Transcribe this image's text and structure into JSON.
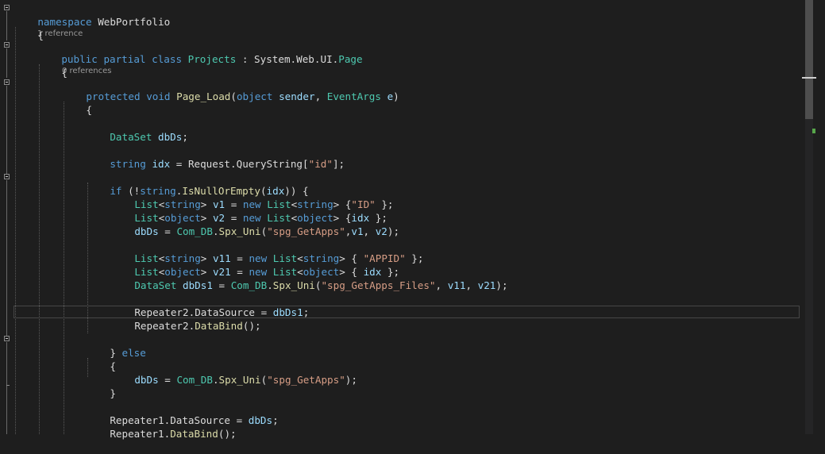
{
  "codelens": {
    "class_refs": "1 reference",
    "method_refs": "0 references"
  },
  "code": {
    "l1": [
      "namespace",
      " ",
      "WebPortfolio"
    ],
    "l2": [
      "{"
    ],
    "l3": [
      "public",
      " ",
      "partial",
      " ",
      "class",
      " ",
      "Projects",
      " : ",
      "System",
      ".",
      "Web",
      ".",
      "UI",
      ".",
      "Page"
    ],
    "l4": [
      "{"
    ],
    "l5": [
      "protected",
      " ",
      "void",
      " ",
      "Page_Load",
      "(",
      "object",
      " ",
      "sender",
      ", ",
      "EventArgs",
      " ",
      "e",
      ")"
    ],
    "l6": [
      "{"
    ],
    "l7": [
      "DataSet",
      " ",
      "dbDs",
      ";"
    ],
    "l8": [
      "string",
      " ",
      "idx",
      " = ",
      "Request",
      ".",
      "QueryString",
      "[",
      "\"id\"",
      "];"
    ],
    "l9": [
      "if",
      " (!",
      "string",
      ".",
      "IsNullOrEmpty",
      "(",
      "idx",
      ")) {"
    ],
    "l10": [
      "List",
      "<",
      "string",
      "> ",
      "v1",
      " = ",
      "new",
      " ",
      "List",
      "<",
      "string",
      "> {",
      "\"ID\"",
      " };"
    ],
    "l11": [
      "List",
      "<",
      "object",
      "> ",
      "v2",
      " = ",
      "new",
      " ",
      "List",
      "<",
      "object",
      "> {",
      "idx",
      " };"
    ],
    "l12": [
      "dbDs",
      " = ",
      "Com_DB",
      ".",
      "Spx_Uni",
      "(",
      "\"spg_GetApps\"",
      ",",
      "v1",
      ", ",
      "v2",
      ");"
    ],
    "l13": [
      "List",
      "<",
      "string",
      "> ",
      "v11",
      " = ",
      "new",
      " ",
      "List",
      "<",
      "string",
      "> { ",
      "\"APPID\"",
      " };"
    ],
    "l14": [
      "List",
      "<",
      "object",
      "> ",
      "v21",
      " = ",
      "new",
      " ",
      "List",
      "<",
      "object",
      "> { ",
      "idx",
      " };"
    ],
    "l15": [
      "DataSet",
      " ",
      "dbDs1",
      " = ",
      "Com_DB",
      ".",
      "Spx_Uni",
      "(",
      "\"spg_GetApps_Files\"",
      ", ",
      "v11",
      ", ",
      "v21",
      ");"
    ],
    "l16": [
      "Repeater2",
      ".",
      "DataSource",
      " = ",
      "dbDs1",
      ";"
    ],
    "l17": [
      "Repeater2",
      ".",
      "DataBind",
      "();"
    ],
    "l18": [
      "} ",
      "else"
    ],
    "l19": [
      "{"
    ],
    "l20": [
      "dbDs",
      " = ",
      "Com_DB",
      ".",
      "Spx_Uni",
      "(",
      "\"spg_GetApps\"",
      ");"
    ],
    "l21": [
      "}"
    ],
    "l22": [
      "Repeater1",
      ".",
      "DataSource",
      " = ",
      "dbDs",
      ";"
    ],
    "l23": [
      "Repeater1",
      ".",
      "DataBind",
      "();"
    ]
  }
}
